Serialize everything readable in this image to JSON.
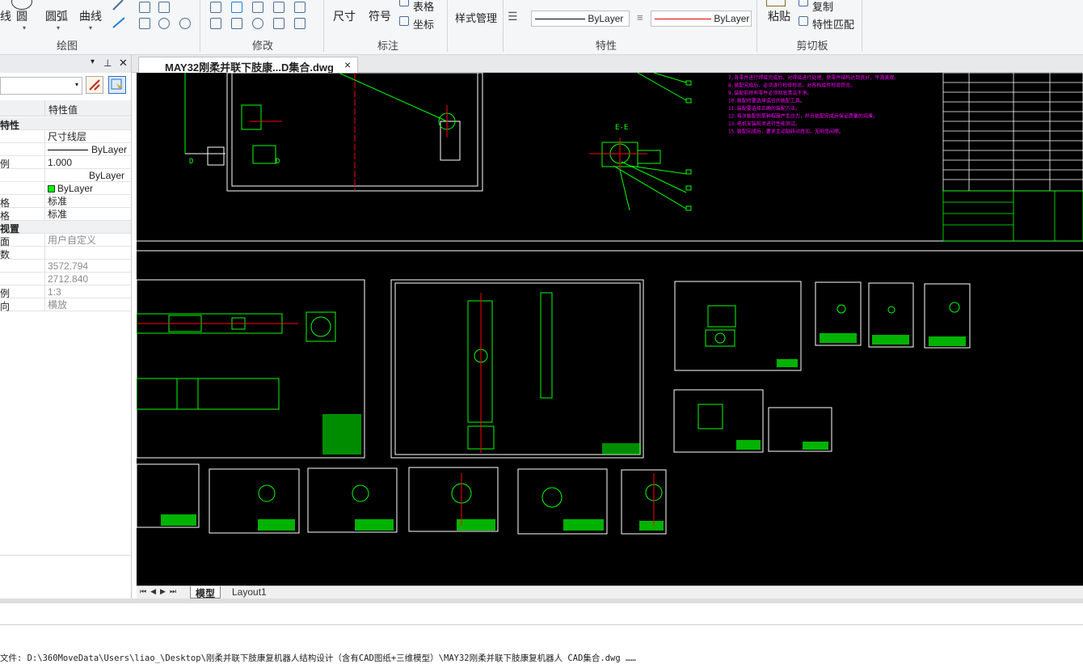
{
  "ribbon": {
    "draw": {
      "label": "绘图",
      "circle": "圆",
      "arc": "圆弧",
      "curve": "曲线",
      "line_partial": "线"
    },
    "modify": {
      "label": "修改"
    },
    "annotate": {
      "label": "标注",
      "dimension": "尺寸",
      "symbol": "符号",
      "table": "表格",
      "coord": "坐标"
    },
    "properties": {
      "label": "特性",
      "style_manager": "样式管理",
      "linetype": "ByLayer",
      "lineweight": "ByLayer"
    },
    "clipboard": {
      "label": "剪切板",
      "paste": "粘贴",
      "copy": "复制",
      "match_props": "特性匹配"
    }
  },
  "palette": {
    "pin_icon": "pin-icon",
    "close_icon": "close-icon",
    "col_value": "特性值",
    "rows": [
      {
        "k": "特性",
        "v": "",
        "hdr": true
      },
      {
        "k": "",
        "v": "尺寸线层"
      },
      {
        "k": "",
        "v": "ByLayer",
        "line": true
      },
      {
        "k": "例",
        "v": "1.000"
      },
      {
        "k": "",
        "v": "ByLayer",
        "right": true
      },
      {
        "k": "",
        "v": "ByLayer",
        "swatch": "#00ff00"
      },
      {
        "k": "格",
        "v": "标准"
      },
      {
        "k": "格",
        "v": "标准"
      },
      {
        "k": "视置",
        "v": "",
        "hdr": true
      },
      {
        "k": "面",
        "v": "用户自定义",
        "gray": true
      },
      {
        "k": "数",
        "v": "",
        "gray": true
      },
      {
        "k": "",
        "v": "3572.794",
        "gray": true
      },
      {
        "k": "",
        "v": "2712.840",
        "gray": true
      },
      {
        "k": "例",
        "v": "1:3",
        "gray": true
      },
      {
        "k": "向",
        "v": "横放",
        "gray": true
      }
    ]
  },
  "document": {
    "tab_title": "MAY32刚柔并联下肢康...D集合.dwg",
    "tab_close": "×"
  },
  "canvas": {
    "section_label": "E-E",
    "notes": [
      "7.各零件进行焊接完成后，对焊接进行处理，使零件结构达到良好，平滑美观。",
      "8.装配完成后，必须进行检修检验，对各构成件检验符合。",
      "9.装配前将有零件必须彻底清洁干净。",
      "10.装配时要选择适合的装配工具。",
      "11.装配要选择正确的装配方法。",
      "12.每次装配到某种程度产生应力，并且装配完成后保证质量的润滑。",
      "13.电机安装前须进行性能测试。",
      "15.装配完成后，要求主动轴转动自如，无明显间隙。"
    ]
  },
  "layout_tabs": {
    "model": "模型",
    "layout1": "Layout1"
  },
  "command": {
    "status": "文件: D:\\360MoveData\\Users\\liao_\\Desktop\\刚柔并联下肢康复机器人结构设计（含有CAD图纸+三维模型）\\MAY32刚柔并联下肢康复机器人 CAD集合.dwg ……"
  },
  "colors": {
    "canvas_bg": "#000000",
    "sheet_border": "#ffffff",
    "geometry": "#00ff00",
    "center_line": "#ff0000",
    "notes": "#ff00ff",
    "accent": "#0070c0"
  }
}
